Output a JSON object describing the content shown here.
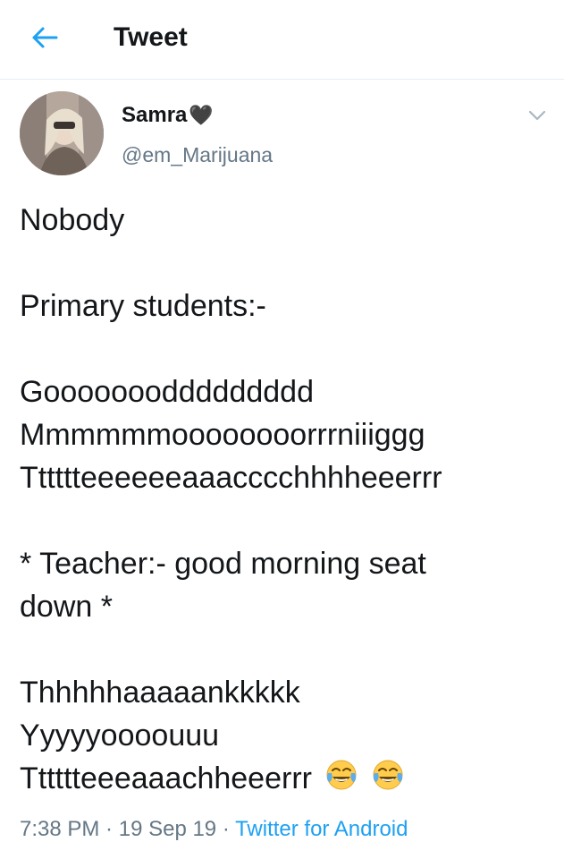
{
  "header": {
    "title": "Tweet",
    "back_icon": "arrow-left-icon",
    "accent": "#1da1f2"
  },
  "author": {
    "display_name": "Samra",
    "name_emoji": "🖤",
    "handle": "@em_Marijuana"
  },
  "tweet": {
    "lines": [
      "Nobody",
      "",
      "Primary students:-",
      "",
      "Goooooooddddddddd",
      "Mmmmmmoooooooorrrniiiggg",
      "Tttttteeeeeeaaacccchhhheeerrr",
      "",
      "* Teacher:- good morning seat",
      "down *",
      "",
      "Thhhhhaaaaankkkkk",
      "Yyyyyoooouuu",
      "Tttttteeeaaachheeerrr"
    ],
    "emoji_count": 2,
    "emoji_icon": "face-with-tears-of-joy-icon"
  },
  "meta": {
    "time": "7:38 PM",
    "sep1": " · ",
    "date": "19 Sep 19",
    "sep2": " · ",
    "source": "Twitter for Android",
    "link_color": "#1da1f2",
    "muted_color": "#657786"
  }
}
